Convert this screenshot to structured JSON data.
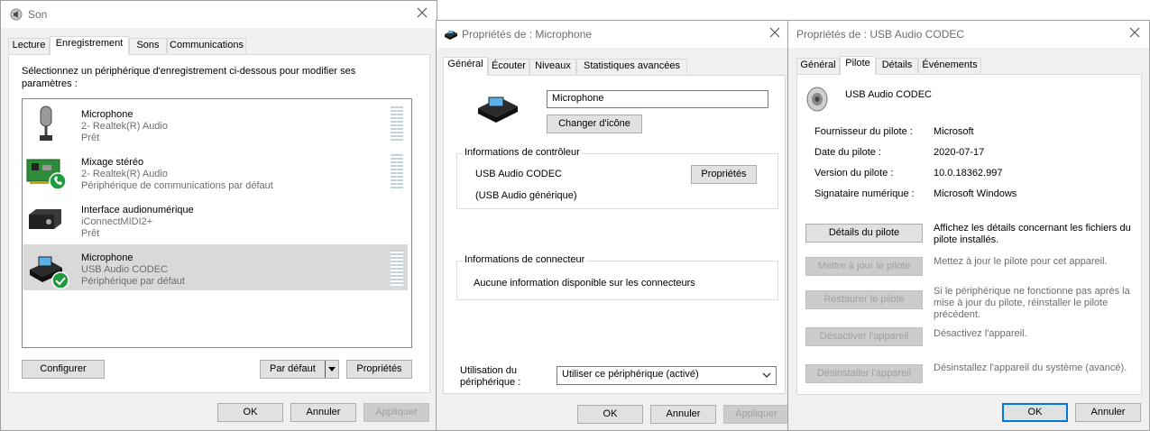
{
  "son": {
    "title": "Son",
    "tabs": [
      "Lecture",
      "Enregistrement",
      "Sons",
      "Communications"
    ],
    "instruction": "Sélectionnez un périphérique d'enregistrement ci-dessous pour modifier ses paramètres :",
    "devices": [
      {
        "name": "Microphone",
        "sub1": "2- Realtek(R) Audio",
        "sub2": "Prêt"
      },
      {
        "name": "Mixage stéréo",
        "sub1": "2- Realtek(R) Audio",
        "sub2": "Périphérique de communications par défaut"
      },
      {
        "name": "Interface audionumérique",
        "sub1": "iConnectMIDI2+",
        "sub2": "Prêt"
      },
      {
        "name": "Microphone",
        "sub1": "USB Audio CODEC",
        "sub2": "Périphérique par défaut"
      }
    ],
    "configure": "Configurer",
    "default": "Par défaut",
    "properties": "Propriétés",
    "ok": "OK",
    "cancel": "Annuler",
    "apply": "Appliquer"
  },
  "micprops": {
    "title": "Propriétés de : Microphone",
    "tabs": [
      "Général",
      "Écouter",
      "Niveaux",
      "Statistiques avancées"
    ],
    "name_value": "Microphone",
    "change_icon": "Changer d'icône",
    "controller_group": "Informations de contrôleur",
    "controller_name": "USB Audio CODEC",
    "controller_props": "Propriétés",
    "controller_type": "(USB Audio générique)",
    "connector_group": "Informations de connecteur",
    "connector_info": "Aucune information disponible sur les connecteurs",
    "usage_label_1": "Utilisation du",
    "usage_label_2": "périphérique :",
    "usage_value": "Utiliser ce périphérique (activé)",
    "ok": "OK",
    "cancel": "Annuler",
    "apply": "Appliquer"
  },
  "usbprops": {
    "title": "Propriétés de : USB Audio CODEC",
    "tabs": [
      "Général",
      "Pilote",
      "Détails",
      "Événements"
    ],
    "device_name": "USB Audio CODEC",
    "info": [
      {
        "label": "Fournisseur du pilote :",
        "value": "Microsoft"
      },
      {
        "label": "Date du pilote :",
        "value": "2020-07-17"
      },
      {
        "label": "Version du pilote :",
        "value": "10.0.18362.997"
      },
      {
        "label": "Signataire numérique :",
        "value": "Microsoft Windows"
      }
    ],
    "actions": [
      {
        "button": "Détails du pilote",
        "desc1": "Affichez les détails concernant les fichiers du",
        "desc2": "pilote installés.",
        "desc3": ""
      },
      {
        "button": "Mettre à jour le pilote",
        "desc1": "Mettez à jour le pilote pour cet appareil.",
        "desc2": "",
        "desc3": ""
      },
      {
        "button": "Restaurer le pilote",
        "desc1": "Si le périphérique ne fonctionne pas après la",
        "desc2": "mise à jour du pilote, réinstaller le pilote",
        "desc3": "précédent."
      },
      {
        "button": "Désactiver l'appareil",
        "desc1": "Désactivez l'appareil.",
        "desc2": "",
        "desc3": ""
      },
      {
        "button": "Désinstaller l'appareil",
        "desc1": "Désinstallez l'appareil du système (avancé).",
        "desc2": "",
        "desc3": ""
      }
    ],
    "ok": "OK",
    "cancel": "Annuler"
  }
}
